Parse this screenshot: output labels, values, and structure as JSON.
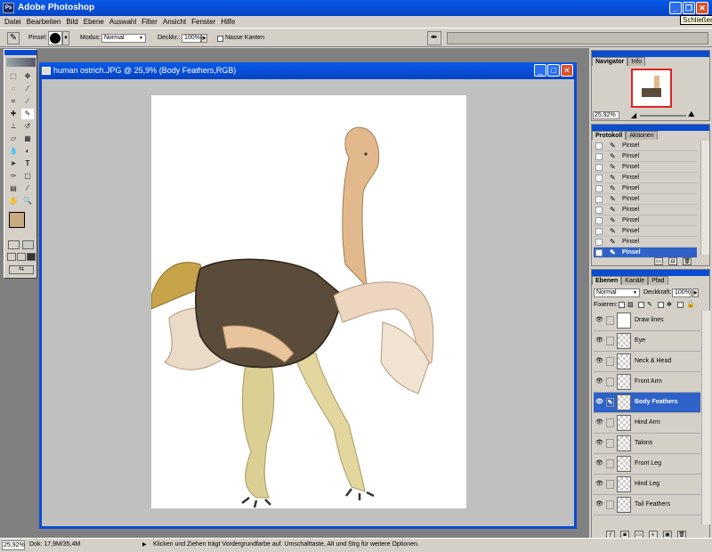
{
  "window": {
    "title": "Adobe Photoshop",
    "app_icon": "Ps",
    "tooltip": "Schließen"
  },
  "menu": [
    "Datei",
    "Bearbeiten",
    "Bild",
    "Ebene",
    "Auswahl",
    "Filter",
    "Ansicht",
    "Fenster",
    "Hilfe"
  ],
  "options": {
    "brush_label": "Pinsel:",
    "mode_label": "Modus:",
    "mode_value": "Normal",
    "opacity_label": "Deckkr.:",
    "opacity_value": "100%",
    "wet_edges_label": "Nasse Kanten"
  },
  "document": {
    "title": "human ostrich.JPG @ 25,9% (Body Feathers,RGB)"
  },
  "navigator": {
    "tabs": [
      "Navigator",
      "Info"
    ],
    "zoom": "25,92%"
  },
  "history": {
    "tabs": [
      "Protokoll",
      "Aktionen"
    ],
    "items": [
      "Pinsel",
      "Pinsel",
      "Pinsel",
      "Pinsel",
      "Pinsel",
      "Pinsel",
      "Pinsel",
      "Pinsel",
      "Pinsel",
      "Pinsel",
      "Pinsel"
    ],
    "selected_index": 10
  },
  "layers": {
    "tabs": [
      "Ebenen",
      "Kanäle",
      "Pfad"
    ],
    "blend_mode": "Normal",
    "opacity_label": "Deckkraft:",
    "opacity_value": "100%",
    "lock_label": "Fixieren:",
    "items": [
      "Draw lines",
      "Eye",
      "Neck & Head",
      "Front Arm",
      "Body Feathers",
      "Hind Arm",
      "Talons",
      "Front Leg",
      "Hind Leg",
      "Tail Feathers"
    ],
    "selected_index": 4
  },
  "status": {
    "zoom": "25,92%",
    "doc": "Dok: 17,9M/35,4M",
    "hint": "Klicken und Ziehen trägt Vordergrundfarbe auf. Umschalttaste, Alt und Strg für weitere Optionen."
  },
  "colors": {
    "foreground": "#c8aa80",
    "background": "#ffffff",
    "accent": "#0a4bd0"
  }
}
